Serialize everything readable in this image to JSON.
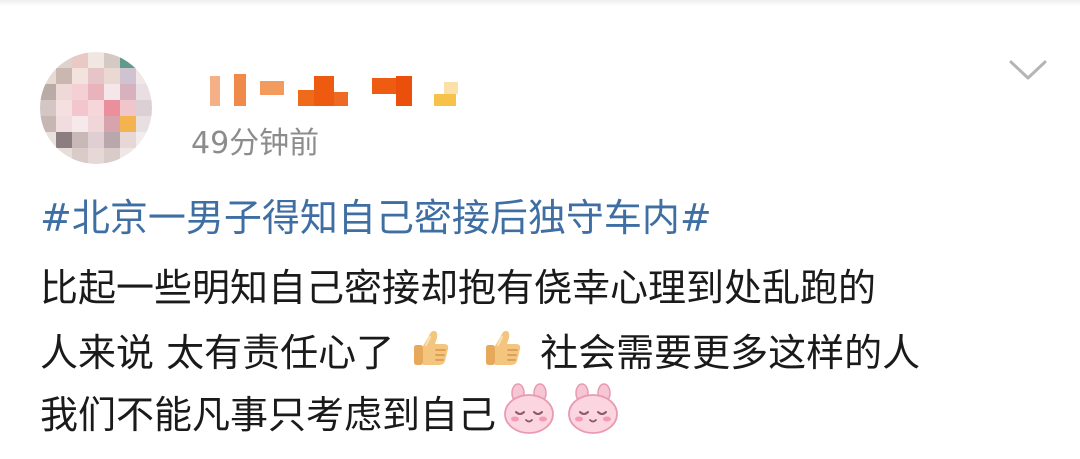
{
  "post": {
    "timestamp": "49分钟前",
    "topic": "#北京一男子得知自己密接后独守车内#",
    "line1": "比起一些明知自己密接却抱有侥幸心理到处乱跑的",
    "line2_a": "人来说 太有责任心了",
    "line2_b": "社会需要更多这样的人",
    "line3": "我们不能凡事只考虑到自己"
  },
  "icons": {
    "more": "chevron-down-icon",
    "thumbs": "thumbs-up-icon",
    "bunny": "pink-bunny-face-icon"
  },
  "colors": {
    "topic": "#3f6ea3",
    "timestamp": "#8c8c8c",
    "text": "#1a1a1a"
  }
}
